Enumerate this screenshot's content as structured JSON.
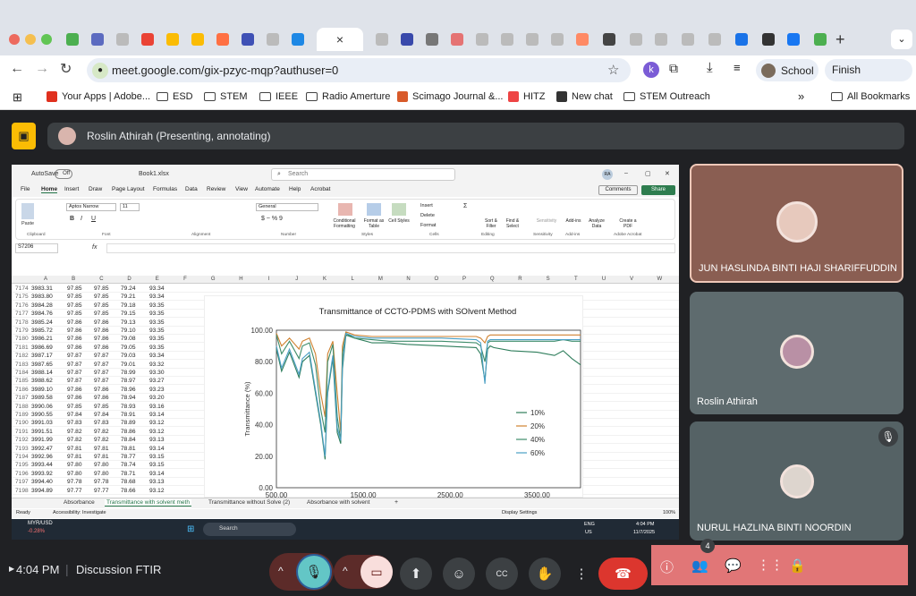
{
  "browser": {
    "tab_active_label": "×",
    "url": "meet.google.com/gix-pzyc-mqp?authuser=0",
    "profile_button": "School",
    "update_button": "Finish update",
    "bookmarks": [
      {
        "label": "Your Apps | Adobe...",
        "icon": "adobe-icon"
      },
      {
        "label": "ESD",
        "icon": "folder-icon"
      },
      {
        "label": "STEM",
        "icon": "folder-icon"
      },
      {
        "label": "IEEE",
        "icon": "folder-icon"
      },
      {
        "label": "Radio Amerture",
        "icon": "folder-icon"
      },
      {
        "label": "Scimago Journal &...",
        "icon": "sjr-icon"
      },
      {
        "label": "HITZ",
        "icon": "hitz-icon"
      },
      {
        "label": "New chat",
        "icon": "chat-icon"
      },
      {
        "label": "STEM Outreach",
        "icon": "folder-icon"
      }
    ],
    "more_bookmarks": "»",
    "all_bookmarks": "All Bookmarks"
  },
  "meet": {
    "presenter_banner": "Roslin Athirah (Presenting, annotating)",
    "participants": [
      {
        "name": "JUN HASLINDA BINTI HAJI SHARIFFUDDIN",
        "muted": false
      },
      {
        "name": "Roslin Athirah",
        "muted": false
      },
      {
        "name": "NURUL HAZLINA BINTI NOORDIN",
        "muted": true
      }
    ],
    "time": "4:04 PM",
    "meeting_name": "Discussion FTIR",
    "people_count": "4"
  },
  "excel": {
    "autosave_label": "AutoSave",
    "autosave_state": "Off",
    "file_name": "Book1.xlsx",
    "search_placeholder": "Search",
    "user_initials": "RA",
    "menu": [
      "File",
      "Home",
      "Insert",
      "Draw",
      "Page Layout",
      "Formulas",
      "Data",
      "Review",
      "View",
      "Automate",
      "Help",
      "Acrobat"
    ],
    "comments_button": "Comments",
    "share_button": "Share",
    "font_name": "Aptos Narrow",
    "font_size": "11",
    "number_format": "General",
    "ribbon_groups": [
      "Clipboard",
      "Font",
      "Alignment",
      "Number",
      "Styles",
      "Cells",
      "Editing",
      "Sensitivity",
      "Add-ins",
      "Adobe Acrobat"
    ],
    "ribbon_buttons": {
      "paste": "Paste",
      "cond_format": "Conditional Formatting",
      "format_table": "Format as Table",
      "cell_styles": "Cell Styles",
      "insert": "Insert",
      "delete": "Delete",
      "format": "Format",
      "sort_filter": "Sort & Filter",
      "find_select": "Find & Select",
      "sensitivity": "Sensitivity",
      "addins": "Add-ins",
      "analyze": "Analyze Data",
      "create_pdf": "Create a PDF"
    },
    "name_box": "S7206",
    "fx": "fx",
    "columns": [
      "A",
      "B",
      "C",
      "D",
      "E",
      "F",
      "G",
      "H",
      "I",
      "J",
      "K",
      "L",
      "M",
      "N",
      "O",
      "P",
      "Q",
      "R",
      "S",
      "T",
      "U",
      "V",
      "W"
    ],
    "rows": [
      [
        "7174",
        "3983.31",
        "97.85",
        "97.85",
        "79.24",
        "93.34"
      ],
      [
        "7175",
        "3983.80",
        "97.85",
        "97.85",
        "79.21",
        "93.34"
      ],
      [
        "7176",
        "3984.28",
        "97.85",
        "97.85",
        "79.18",
        "93.35"
      ],
      [
        "7177",
        "3984.76",
        "97.85",
        "97.85",
        "79.15",
        "93.35"
      ],
      [
        "7178",
        "3985.24",
        "97.86",
        "97.86",
        "79.13",
        "93.35"
      ],
      [
        "7179",
        "3985.72",
        "97.86",
        "97.86",
        "79.10",
        "93.35"
      ],
      [
        "7180",
        "3986.21",
        "97.86",
        "97.86",
        "79.08",
        "93.35"
      ],
      [
        "7181",
        "3986.69",
        "97.86",
        "97.86",
        "79.05",
        "93.35"
      ],
      [
        "7182",
        "3987.17",
        "97.87",
        "97.87",
        "79.03",
        "93.34"
      ],
      [
        "7183",
        "3987.65",
        "97.87",
        "97.87",
        "79.01",
        "93.32"
      ],
      [
        "7184",
        "3988.14",
        "97.87",
        "97.87",
        "78.99",
        "93.30"
      ],
      [
        "7185",
        "3988.62",
        "97.87",
        "97.87",
        "78.97",
        "93.27"
      ],
      [
        "7186",
        "3989.10",
        "97.86",
        "97.86",
        "78.96",
        "93.23"
      ],
      [
        "7187",
        "3989.58",
        "97.86",
        "97.86",
        "78.94",
        "93.20"
      ],
      [
        "7188",
        "3990.06",
        "97.85",
        "97.85",
        "78.93",
        "93.16"
      ],
      [
        "7189",
        "3990.55",
        "97.84",
        "97.84",
        "78.91",
        "93.14"
      ],
      [
        "7190",
        "3991.03",
        "97.83",
        "97.83",
        "78.89",
        "93.12"
      ],
      [
        "7191",
        "3991.51",
        "97.82",
        "97.82",
        "78.86",
        "93.12"
      ],
      [
        "7192",
        "3991.99",
        "97.82",
        "97.82",
        "78.84",
        "93.13"
      ],
      [
        "7193",
        "3992.47",
        "97.81",
        "97.81",
        "78.81",
        "93.14"
      ],
      [
        "7194",
        "3992.96",
        "97.81",
        "97.81",
        "78.77",
        "93.15"
      ],
      [
        "7195",
        "3993.44",
        "97.80",
        "97.80",
        "78.74",
        "93.15"
      ],
      [
        "7196",
        "3993.92",
        "97.80",
        "97.80",
        "78.71",
        "93.14"
      ],
      [
        "7197",
        "3994.40",
        "97.78",
        "97.78",
        "78.68",
        "93.13"
      ],
      [
        "7198",
        "3994.89",
        "97.77",
        "97.77",
        "78.66",
        "93.12"
      ]
    ],
    "sheet_tabs": [
      "Absorbance",
      "Transmittance with solvent meth",
      "Transmittance without Solve (2)",
      "Absorbance with  solvent"
    ],
    "active_sheet": 1,
    "status_ready": "Ready",
    "status_accessibility": "Accessibility: Investigate",
    "display_settings": "Display Settings",
    "zoom": "100%"
  },
  "taskbar": {
    "ticker": "MYR/USD",
    "ticker_change": "-0.28%",
    "search": "Search",
    "lang": "ENG",
    "region": "US",
    "time": "4:04 PM",
    "date": "11/7/2025"
  },
  "chart_data": {
    "type": "line",
    "title": "Transmittance of CCTO-PDMS with SOlvent Method",
    "xlabel": "",
    "ylabel": "Transmittance (%)",
    "ylim": [
      0,
      100
    ],
    "xlim": [
      500,
      4000
    ],
    "xticks": [
      "500.00",
      "1500.00",
      "2500.00",
      "3500.00"
    ],
    "yticks": [
      "100.00",
      "80.00",
      "60.00",
      "40.00",
      "20.00",
      "0.00"
    ],
    "legend_position": "right",
    "series": [
      {
        "name": "10%",
        "color": "#2e7d5b",
        "x": [
          500,
          560,
          650,
          760,
          800,
          880,
          950,
          1010,
          1060,
          1090,
          1150,
          1200,
          1240,
          1260,
          1300,
          1400,
          1600,
          1800,
          2000,
          2400,
          2800,
          2850,
          2900,
          2930,
          2960,
          3000,
          3200,
          3500,
          3700,
          3800,
          3900,
          4000
        ],
        "y": [
          88,
          74,
          86,
          70,
          80,
          84,
          60,
          40,
          18,
          60,
          82,
          35,
          28,
          75,
          97,
          95,
          92,
          92,
          91,
          90,
          89,
          85,
          68,
          88,
          90,
          89,
          87,
          86,
          84,
          87,
          82,
          78
        ]
      },
      {
        "name": "20%",
        "color": "#d0812f",
        "x": [
          500,
          560,
          650,
          760,
          800,
          880,
          950,
          1010,
          1060,
          1090,
          1150,
          1200,
          1240,
          1260,
          1300,
          1400,
          1600,
          1800,
          2000,
          2400,
          2800,
          2850,
          2900,
          2930,
          2960,
          3000,
          3200,
          3500,
          3700,
          3800,
          3900,
          4000
        ],
        "y": [
          98,
          90,
          95,
          88,
          93,
          95,
          85,
          60,
          45,
          85,
          93,
          60,
          35,
          90,
          99,
          97,
          96,
          96,
          96,
          96,
          96,
          95,
          92,
          96,
          97,
          97,
          97,
          97,
          97,
          97,
          97,
          97
        ]
      },
      {
        "name": "40%",
        "color": "#3e8c6a",
        "x": [
          500,
          560,
          650,
          760,
          800,
          880,
          950,
          1010,
          1060,
          1090,
          1150,
          1200,
          1240,
          1260,
          1300,
          1400,
          1600,
          1800,
          2000,
          2400,
          2800,
          2850,
          2900,
          2930,
          2960,
          3000,
          3200,
          3500,
          3700,
          3800,
          3900,
          4000
        ],
        "y": [
          97,
          85,
          93,
          82,
          90,
          92,
          78,
          50,
          35,
          80,
          91,
          45,
          30,
          85,
          98,
          95,
          94,
          93,
          93,
          93,
          92,
          90,
          80,
          92,
          93,
          93,
          93,
          93,
          93,
          94,
          93,
          93
        ]
      },
      {
        "name": "60%",
        "color": "#4a9fc5",
        "x": [
          500,
          560,
          650,
          760,
          800,
          880,
          950,
          1010,
          1060,
          1090,
          1150,
          1200,
          1240,
          1260,
          1300,
          1400,
          1600,
          1800,
          2000,
          2400,
          2800,
          2850,
          2900,
          2930,
          2960,
          3000,
          3200,
          3500,
          3700,
          3800,
          3900,
          4000
        ],
        "y": [
          90,
          76,
          88,
          72,
          82,
          86,
          62,
          42,
          20,
          62,
          84,
          38,
          30,
          78,
          98,
          96,
          95,
          95,
          95,
          95,
          94,
          92,
          66,
          93,
          94,
          94,
          94,
          94,
          94,
          94,
          94,
          94
        ]
      }
    ]
  }
}
